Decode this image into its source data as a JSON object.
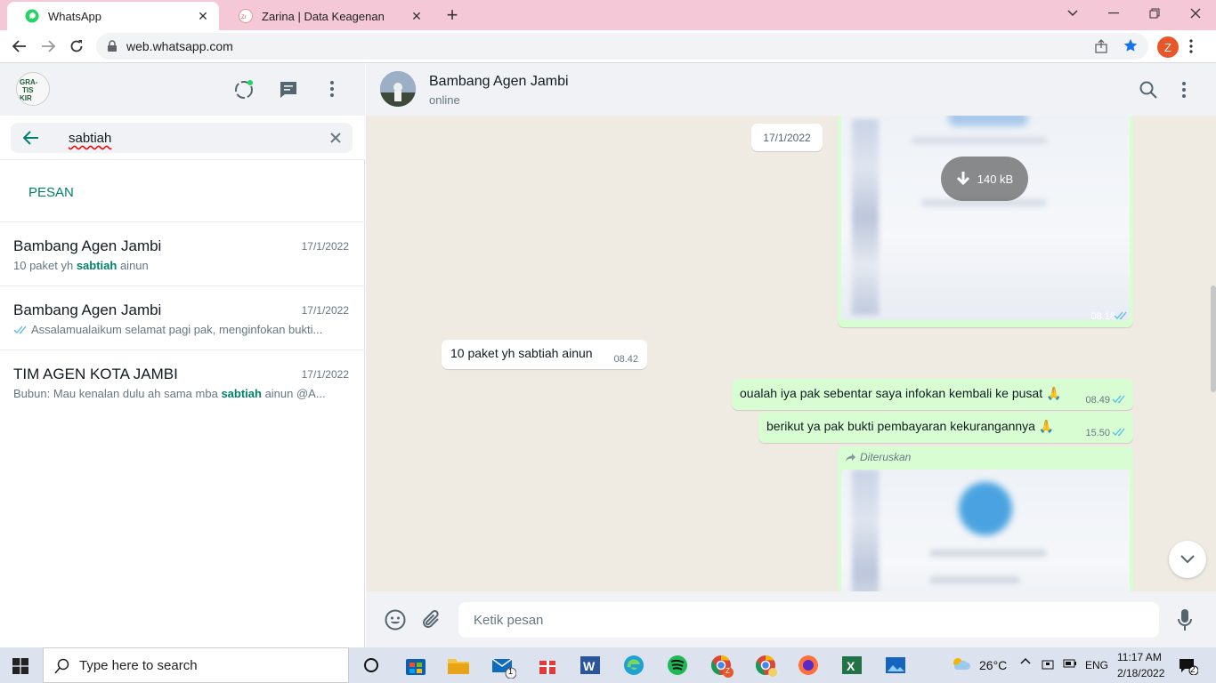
{
  "browser": {
    "tabs": [
      {
        "title": "WhatsApp",
        "active": true
      },
      {
        "title": "Zarina | Data Keagenan",
        "active": false
      }
    ],
    "url": "web.whatsapp.com",
    "profile_initial": "Z"
  },
  "sidebar": {
    "logo_text": "GRA-TIS ONG-KIR",
    "search_value": "sabtiah",
    "section_label": "PESAN",
    "results": [
      {
        "name": "Bambang Agen Jambi",
        "date": "17/1/2022",
        "prefix": "10 paket yh ",
        "match": "sabtiah",
        "suffix": " ainun",
        "read_ticks": false
      },
      {
        "name": "Bambang Agen Jambi",
        "date": "17/1/2022",
        "prefix": "Assalamualaikum selamat pagi pak, menginfokan bukti...",
        "match": "",
        "suffix": "",
        "read_ticks": true
      },
      {
        "name": "TIM AGEN KOTA JAMBI",
        "date": "17/1/2022",
        "prefix": "Bubun: Mau kenalan dulu ah sama mba ",
        "match": "sabtiah",
        "suffix": " ainun @A...",
        "read_ticks": false
      }
    ]
  },
  "chat": {
    "contact_name": "Bambang Agen Jambi",
    "status": "online",
    "date_chip": "17/1/2022",
    "image_download_size": "140 kB",
    "image_time": "08.18",
    "messages": [
      {
        "text": "10 paket yh sabtiah ainun",
        "time": "08.42",
        "direction": "in"
      },
      {
        "text": "oualah iya pak sebentar saya infokan kembali ke pusat",
        "emoji": "🙏",
        "time": "08.49",
        "direction": "out"
      },
      {
        "text": "berikut  ya pak bukti pembayaran kekurangannya",
        "emoji": "🙏",
        "time": "15.50",
        "direction": "out"
      }
    ],
    "forwarded_label": "Diteruskan",
    "compose_placeholder": "Ketik pesan"
  },
  "taskbar": {
    "search_placeholder": "Type here to search",
    "weather": "26°C",
    "language": "ENG",
    "time": "11:17 AM",
    "date": "2/18/2022",
    "notification_count": "2",
    "mail_badge": "1",
    "chrome_badge": "Z"
  },
  "colors": {
    "whatsapp_green": "#008069",
    "outgoing_bubble": "#d9fdd3",
    "tab_strip": "#f4c8d6",
    "read_tick": "#53bdeb"
  }
}
